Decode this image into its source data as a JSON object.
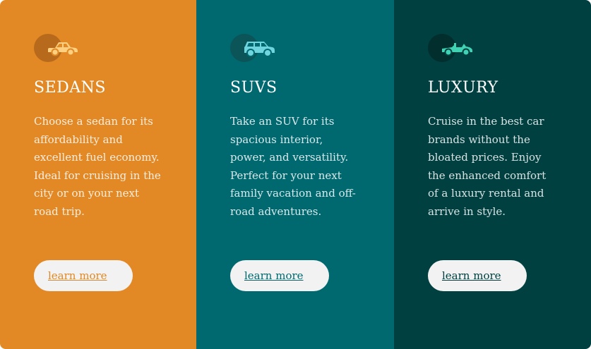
{
  "cards": [
    {
      "title": "SEDANS",
      "icon": "sedan-car-icon",
      "description": "Choose a sedan for its affordability and excellent fuel economy. Ideal for cruising in the city or on your next road trip.",
      "button_label": "learn more",
      "colors": {
        "background": "#E28926",
        "icon": "#FFD080",
        "icon_circle": "#B86A1C",
        "button_text": "#E28926"
      }
    },
    {
      "title": "SUVS",
      "icon": "suv-car-icon",
      "description": "Take an SUV for its spacious interior, power, and versatility. Perfect for your next family vacation and off-road adventures.",
      "button_label": "learn more",
      "colors": {
        "background": "#006970",
        "icon": "#6FD4DD",
        "icon_circle": "#0B5457",
        "button_text": "#006970"
      }
    },
    {
      "title": "LUXURY",
      "icon": "convertible-car-icon",
      "description": "Cruise in the best car brands without the bloated prices. Enjoy the enhanced comfort of a luxury rental and arrive in style.",
      "button_label": "learn more",
      "colors": {
        "background": "#004040",
        "icon": "#3FD2B3",
        "icon_circle": "#022E2E",
        "button_text": "#004040"
      }
    }
  ]
}
